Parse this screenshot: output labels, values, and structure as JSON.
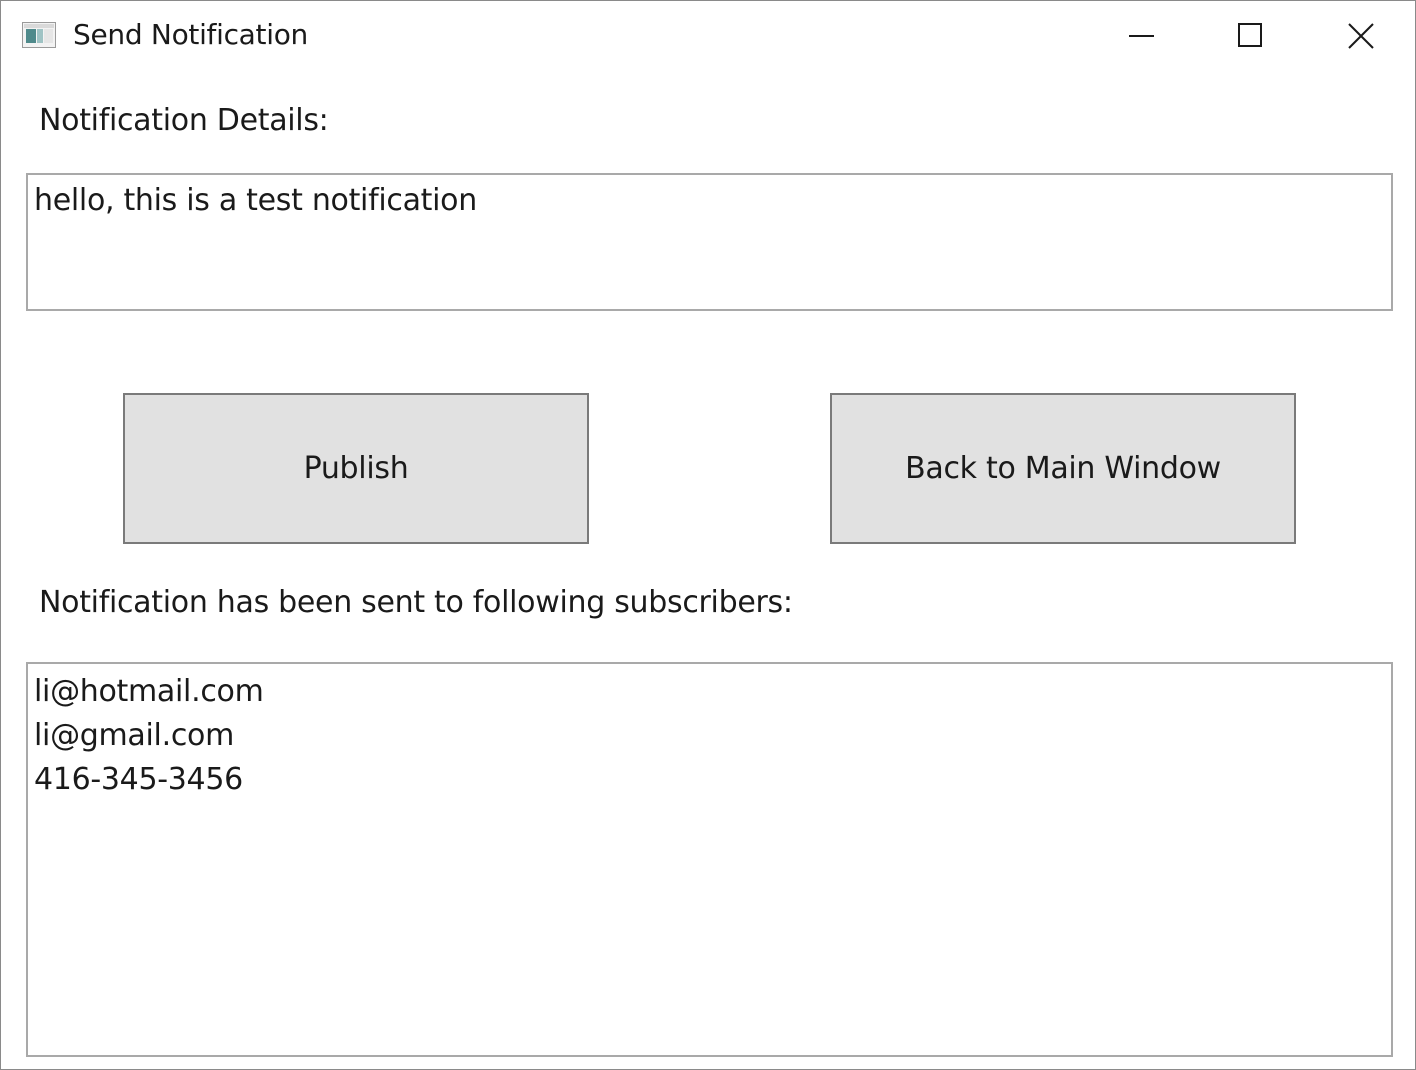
{
  "window": {
    "title": "Send Notification"
  },
  "icons": {
    "app": "window-app-icon",
    "minimize": "minimize-icon",
    "maximize": "maximize-icon",
    "close": "close-icon"
  },
  "details": {
    "label": "Notification Details:",
    "value": "hello, this is a test notification"
  },
  "buttons": {
    "publish": "Publish",
    "back": "Back to Main Window"
  },
  "subscribers": {
    "label": "Notification has been sent to following subscribers:",
    "items": [
      "li@hotmail.com",
      "li@gmail.com",
      "416-345-3456"
    ]
  }
}
